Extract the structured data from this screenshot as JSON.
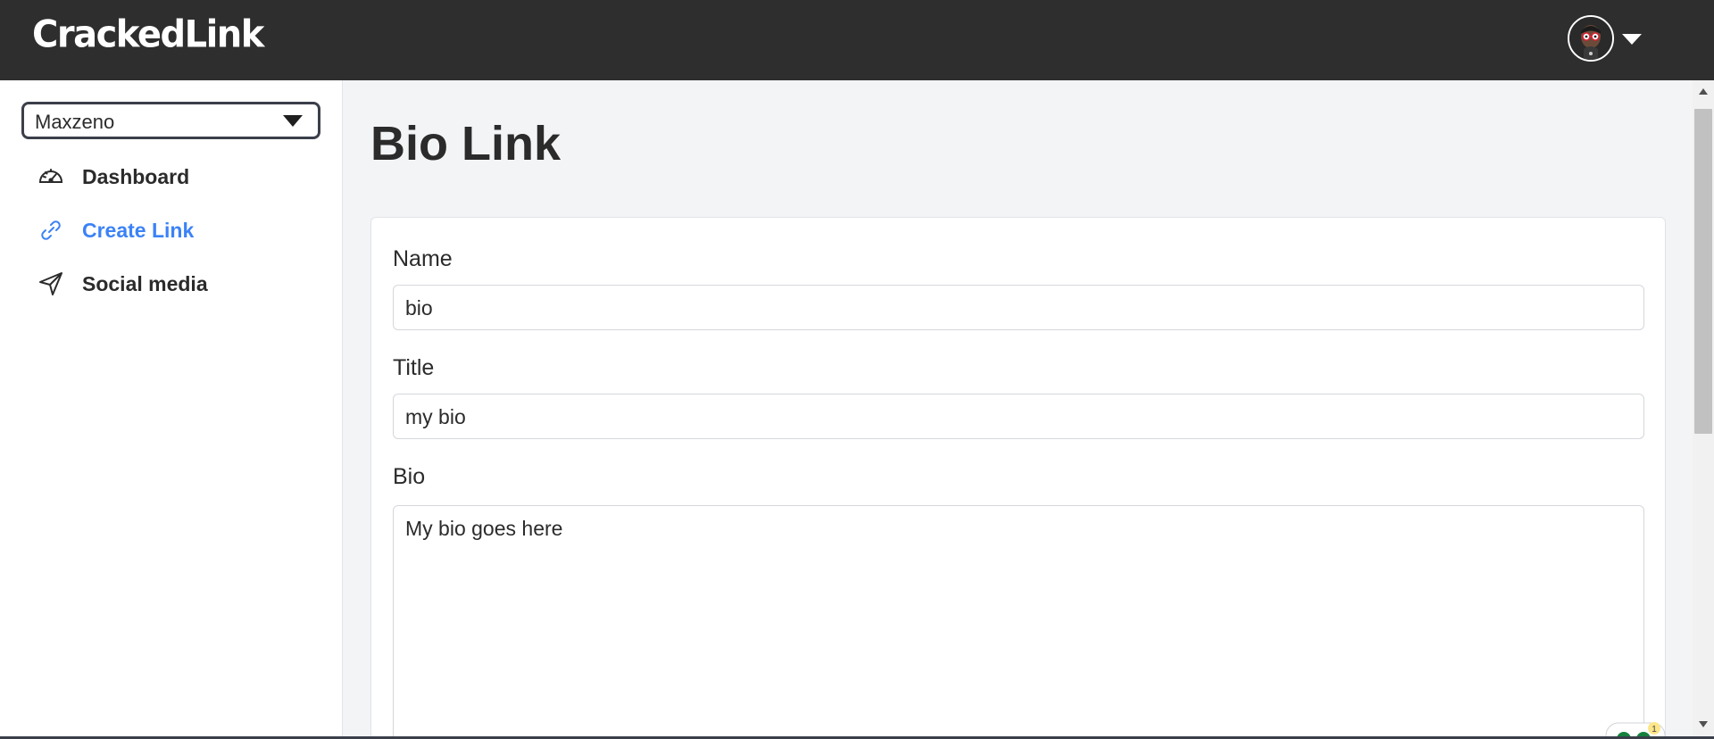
{
  "app": {
    "logo": "CrackedLink"
  },
  "header": {
    "avatar_icon": "user-avatar",
    "menu_icon": "caret-down-icon"
  },
  "sidebar": {
    "workspace_select": {
      "value": "Maxzeno",
      "icon": "caret-down-icon"
    },
    "items": [
      {
        "label": "Dashboard",
        "icon": "speedometer-icon",
        "active": false
      },
      {
        "label": "Create Link",
        "icon": "link-icon",
        "active": true
      },
      {
        "label": "Social media",
        "icon": "send-icon",
        "active": false
      }
    ]
  },
  "main": {
    "title": "Bio Link",
    "form": {
      "name": {
        "label": "Name",
        "value": "bio"
      },
      "title": {
        "label": "Title",
        "value": "my bio"
      },
      "bio": {
        "label": "Bio",
        "value": "My bio goes here"
      },
      "grammar_badge_count": "1"
    }
  },
  "colors": {
    "header_bg": "#2e2e2e",
    "accent": "#3b82f6",
    "page_bg": "#f3f4f6"
  }
}
